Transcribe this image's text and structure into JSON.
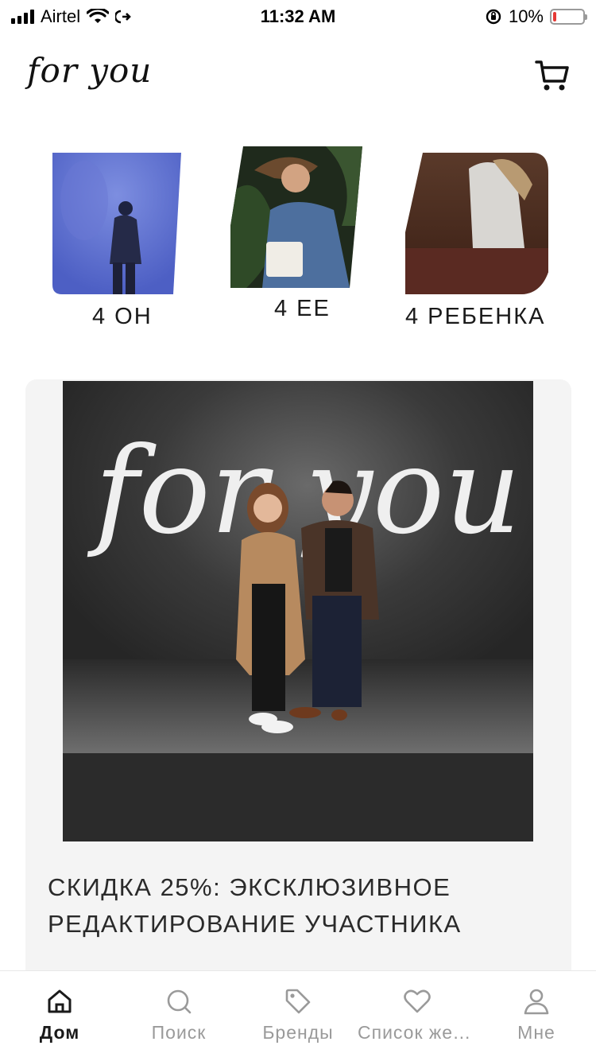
{
  "status_bar": {
    "carrier": "Airtel",
    "time": "11:32 AM",
    "battery_percent": "10%",
    "battery_level": 0.1,
    "battery_color": "#e53935"
  },
  "header": {
    "logo_text": "for you",
    "cart_icon": "cart-icon"
  },
  "categories": [
    {
      "label": "4 ОН"
    },
    {
      "label": "4 ЕЕ"
    },
    {
      "label": "4 РЕБЕНКА"
    }
  ],
  "promo": {
    "banner_logo": "for you",
    "title": "СКИДКА 25%: ЭКСКЛЮЗИВНОЕ РЕДАКТИРОВАНИЕ УЧАСТНИКА"
  },
  "tabbar": {
    "items": [
      {
        "label": "Дом",
        "icon": "home-icon",
        "active": true
      },
      {
        "label": "Поиск",
        "icon": "search-icon",
        "active": false
      },
      {
        "label": "Бренды",
        "icon": "tag-icon",
        "active": false
      },
      {
        "label": "Список желаний",
        "icon": "heart-icon",
        "active": false
      },
      {
        "label": "Мне",
        "icon": "profile-icon",
        "active": false
      }
    ]
  },
  "colors": {
    "accent": "#1a1a1a",
    "inactive": "#9a9a9a",
    "card_bg": "#f4f4f4"
  }
}
